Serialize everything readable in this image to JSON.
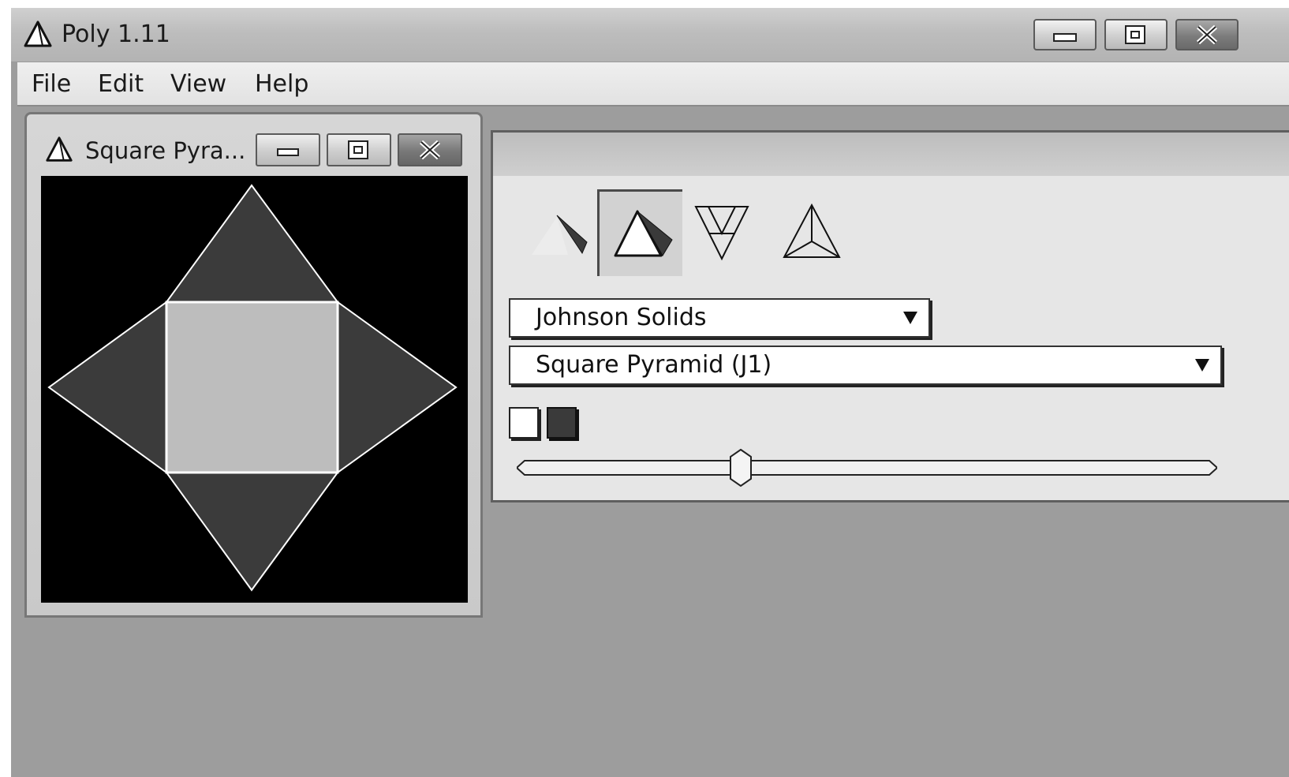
{
  "app": {
    "title": "Poly 1.11",
    "icon": "triangle-polyhedron-icon"
  },
  "window_controls": {
    "minimize_icon": "minimize-icon",
    "maximize_icon": "maximize-icon",
    "close_icon": "close-icon"
  },
  "menu": {
    "items": [
      "File",
      "Edit",
      "View",
      "Help"
    ]
  },
  "child_window": {
    "title": "Square Pyra...",
    "icon": "triangle-polyhedron-icon"
  },
  "controls": {
    "view_modes": [
      {
        "name": "flattened-net-icon"
      },
      {
        "name": "3d-solid-icon"
      },
      {
        "name": "net-diagram-icon"
      },
      {
        "name": "wireframe-icon"
      }
    ],
    "active_view_mode": "3d-solid-icon",
    "category_select": {
      "value": "Johnson Solids"
    },
    "polyhedron_select": {
      "value": "Square Pyramid (J1)"
    },
    "color_swatches": [
      "#ffffff",
      "#3a3a3a"
    ],
    "slider": {
      "value_fraction": 0.32
    }
  },
  "colors": {
    "desktop": "#9d9d9d",
    "viewport_background": "#000000",
    "square_face": "#bdbdbd",
    "triangle_faces": "#3b3b3b",
    "edges": "#ffffff"
  }
}
